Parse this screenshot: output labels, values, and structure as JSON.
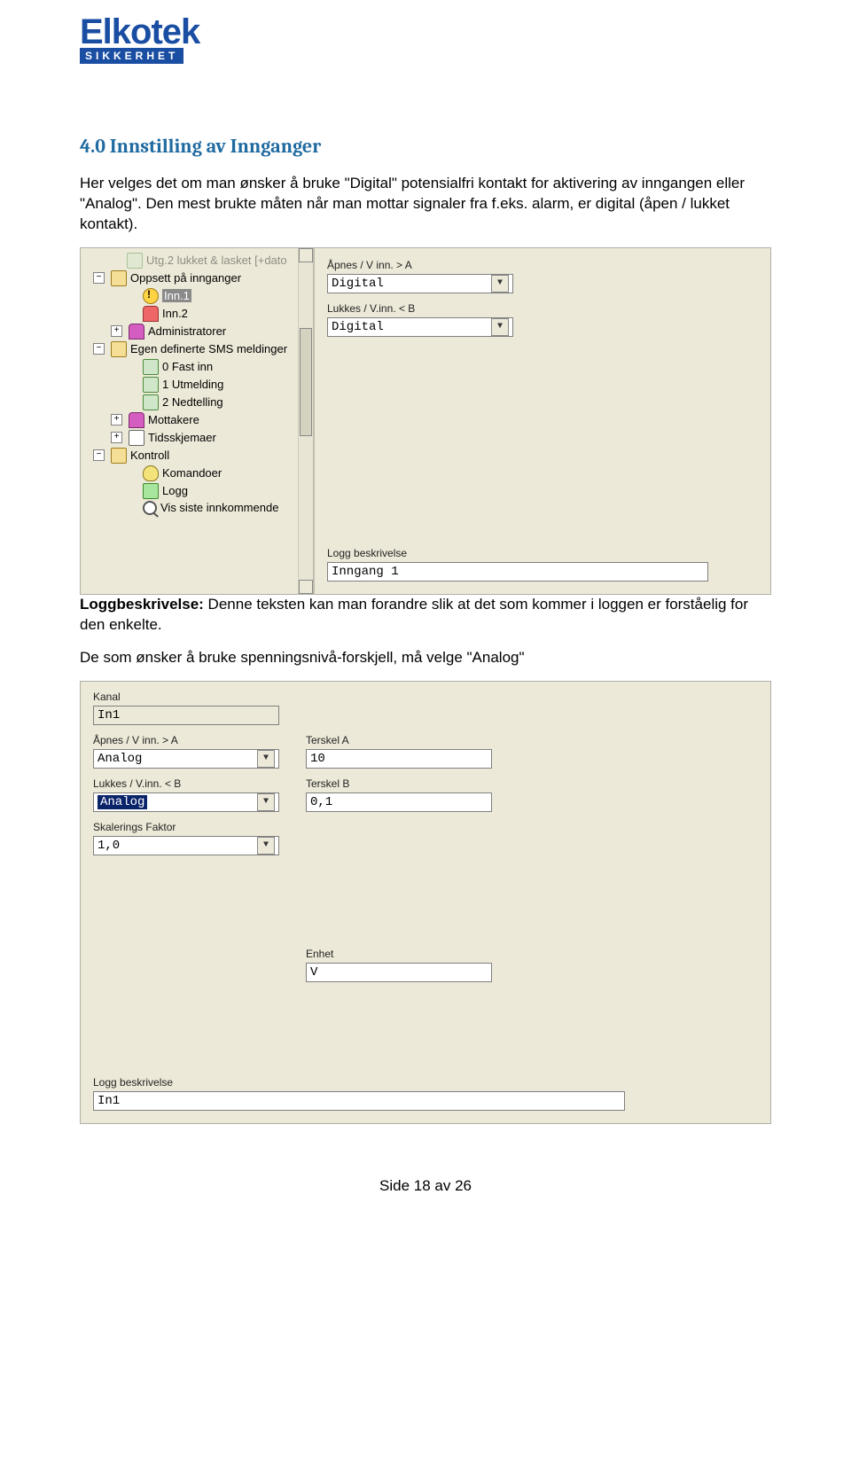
{
  "logo": {
    "name": "Elkotek",
    "tag": "SIKKERHET"
  },
  "heading": "4.0 Innstilling av Innganger",
  "paragraphs": {
    "p1": "Her velges det om man ønsker å bruke \"Digital\" potensialfri kontakt for aktivering av inngangen eller \"Analog\". Den mest brukte måten når man mottar signaler fra f.eks. alarm, er digital (åpen / lukket kontakt).",
    "p2a": "Loggbeskrivelse:",
    "p2b": " Denne teksten kan man forandre slik at det som kommer i loggen er forståelig for den enkelte.",
    "p3": "De som ønsker å bruke spenningsnivå-forskjell, må velge \"Analog\""
  },
  "tree": {
    "top_fade": "Utg.2 lukket & lasket [+dato",
    "items": [
      {
        "indent": "l1",
        "exp": "−",
        "icon": "folderop",
        "label": "Oppsett på innganger"
      },
      {
        "indent": "l3",
        "exp": "",
        "icon": "excl",
        "label": "Inn.1",
        "selected": true
      },
      {
        "indent": "l3",
        "exp": "",
        "icon": "person",
        "label": "Inn.2"
      },
      {
        "indent": "l2",
        "exp": "+",
        "icon": "persons",
        "label": "Administratorer"
      },
      {
        "indent": "l1",
        "exp": "−",
        "icon": "folderop",
        "label": "Egen definerte SMS meldinger"
      },
      {
        "indent": "l3",
        "exp": "",
        "icon": "grid",
        "label": "0 Fast inn"
      },
      {
        "indent": "l3",
        "exp": "",
        "icon": "grid",
        "label": "1 Utmelding"
      },
      {
        "indent": "l3",
        "exp": "",
        "icon": "grid",
        "label": "2 Nedtelling"
      },
      {
        "indent": "l2",
        "exp": "+",
        "icon": "persons",
        "label": "Mottakere"
      },
      {
        "indent": "l2",
        "exp": "+",
        "icon": "calendar",
        "label": "Tidsskjemaer"
      },
      {
        "indent": "l1",
        "exp": "−",
        "icon": "folderop",
        "label": "Kontroll"
      },
      {
        "indent": "l3",
        "exp": "",
        "icon": "bulb",
        "label": "Komandoer"
      },
      {
        "indent": "l3",
        "exp": "",
        "icon": "log",
        "label": "Logg"
      },
      {
        "indent": "l3",
        "exp": "",
        "icon": "magnify",
        "label": "Vis siste innkommende"
      }
    ]
  },
  "fig1": {
    "apnes_label": "Åpnes / V inn. > A",
    "apnes_value": "Digital",
    "lukkes_label": "Lukkes / V.inn. < B",
    "lukkes_value": "Digital",
    "logg_label": "Logg beskrivelse",
    "logg_value": "Inngang 1"
  },
  "fig2": {
    "kanal_label": "Kanal",
    "kanal_value": "In1",
    "apnes_label": "Åpnes / V inn. > A",
    "apnes_value": "Analog",
    "terskelA_label": "Terskel A",
    "terskelA_value": "10",
    "lukkes_label": "Lukkes / V.inn. < B",
    "lukkes_value": "Analog",
    "terskelB_label": "Terskel B",
    "terskelB_value": "0,1",
    "skal_label": "Skalerings Faktor",
    "skal_value": "1,0",
    "enhet_label": "Enhet",
    "enhet_value": "V",
    "logg_label": "Logg beskrivelse",
    "logg_value": "In1"
  },
  "page_number": "Side 18 av 26"
}
